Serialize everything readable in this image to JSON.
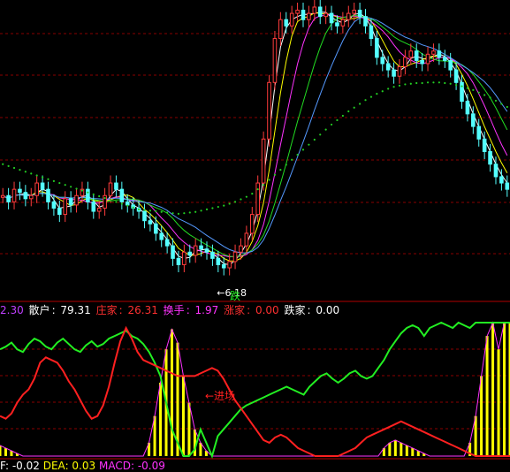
{
  "chart_data": [
    {
      "type": "candlestick",
      "title": "",
      "grid": true,
      "ylim": [
        5.8,
        10.4
      ],
      "annotations": {
        "low_label": "6.18",
        "low_arrow": "←",
        "signal_label": "跌"
      },
      "colors": {
        "up": "#ff3c3c",
        "down": "#54ffff",
        "ma_long": "#22cc22",
        "grid": "#8a0000"
      },
      "candles_close": [
        7.4,
        7.3,
        7.5,
        7.45,
        7.35,
        7.4,
        7.6,
        7.5,
        7.3,
        7.2,
        7.1,
        7.35,
        7.25,
        7.4,
        7.5,
        7.3,
        7.15,
        7.2,
        7.4,
        7.6,
        7.5,
        7.3,
        7.25,
        7.2,
        7.15,
        7.0,
        6.95,
        6.8,
        6.7,
        6.6,
        6.4,
        6.3,
        6.5,
        6.45,
        6.6,
        6.55,
        6.5,
        6.4,
        6.3,
        6.25,
        6.35,
        6.5,
        6.6,
        6.8,
        7.1,
        7.6,
        8.3,
        9.2,
        9.9,
        10.2,
        10.1,
        10.3,
        10.35,
        10.2,
        10.3,
        10.4,
        10.25,
        10.3,
        10.15,
        10.1,
        10.2,
        10.3,
        10.35,
        10.25,
        10.1,
        9.9,
        9.6,
        9.5,
        9.4,
        9.3,
        9.45,
        9.6,
        9.7,
        9.55,
        9.5,
        9.65,
        9.7,
        9.6,
        9.55,
        9.4,
        9.2,
        8.9,
        8.7,
        8.5,
        8.3,
        8.1,
        7.9,
        7.7,
        7.6,
        7.5
      ],
      "ma_long_values": [
        7.9,
        7.87,
        7.84,
        7.81,
        7.78,
        7.75,
        7.72,
        7.69,
        7.66,
        7.63,
        7.6,
        7.57,
        7.54,
        7.51,
        7.48,
        7.45,
        7.42,
        7.39,
        7.36,
        7.33,
        7.3,
        7.27,
        7.24,
        7.21,
        7.18,
        7.17,
        7.16,
        7.15,
        7.14,
        7.13,
        7.12,
        7.11,
        7.12,
        7.13,
        7.14,
        7.16,
        7.18,
        7.2,
        7.22,
        7.24,
        7.27,
        7.3,
        7.34,
        7.38,
        7.43,
        7.5,
        7.57,
        7.65,
        7.73,
        7.81,
        7.89,
        7.97,
        8.05,
        8.13,
        8.21,
        8.29,
        8.37,
        8.45,
        8.53,
        8.6,
        8.67,
        8.74,
        8.8,
        8.86,
        8.92,
        8.97,
        9.02,
        9.06,
        9.1,
        9.13,
        9.15,
        9.17,
        9.18,
        9.19,
        9.19,
        9.2,
        9.2,
        9.2,
        9.19,
        9.18,
        9.16,
        9.14,
        9.11,
        9.08,
        9.04,
        9.0,
        8.96,
        8.91,
        8.86,
        8.81
      ]
    },
    {
      "type": "line",
      "ylim": [
        0,
        100
      ],
      "legend": [
        {
          "name": "",
          "value": "2.30",
          "color": "#c040ff"
        },
        {
          "name": "散户",
          "value": "79.31",
          "color": "#ffffff"
        },
        {
          "name": "庄家",
          "value": "26.31",
          "color": "#ff3030"
        },
        {
          "name": "换手",
          "value": "1.97",
          "color": "#ff33ff"
        },
        {
          "name": "涨家",
          "value": "0.00",
          "color": "#ff3030"
        },
        {
          "name": "跌家",
          "value": "0.00",
          "color": "#ffffff"
        }
      ],
      "annotation": "进场",
      "series": [
        {
          "name": "散户",
          "color": "#22ee22",
          "values": [
            80,
            82,
            85,
            80,
            78,
            84,
            88,
            86,
            82,
            80,
            85,
            88,
            84,
            80,
            78,
            83,
            86,
            82,
            84,
            88,
            90,
            92,
            94,
            90,
            88,
            84,
            78,
            70,
            60,
            40,
            20,
            10,
            0,
            0,
            5,
            20,
            10,
            0,
            15,
            20,
            25,
            30,
            35,
            38,
            40,
            42,
            44,
            46,
            48,
            50,
            52,
            50,
            48,
            46,
            52,
            56,
            60,
            62,
            58,
            55,
            58,
            62,
            64,
            60,
            58,
            60,
            66,
            72,
            80,
            86,
            92,
            96,
            98,
            96,
            90,
            96,
            98,
            100,
            98,
            96,
            100,
            98,
            96,
            100,
            100,
            100,
            100,
            100,
            100,
            100
          ]
        },
        {
          "name": "庄家",
          "color": "#ff2020",
          "values": [
            30,
            28,
            32,
            40,
            46,
            50,
            58,
            70,
            74,
            72,
            70,
            64,
            56,
            50,
            42,
            34,
            28,
            30,
            38,
            52,
            70,
            86,
            96,
            88,
            78,
            72,
            70,
            68,
            66,
            64,
            62,
            60,
            60,
            60,
            60,
            62,
            64,
            66,
            64,
            58,
            50,
            42,
            36,
            30,
            24,
            18,
            12,
            10,
            14,
            16,
            14,
            10,
            6,
            4,
            2,
            0,
            0,
            0,
            0,
            0,
            2,
            4,
            6,
            10,
            14,
            16,
            18,
            20,
            22,
            24,
            26,
            24,
            22,
            20,
            18,
            16,
            14,
            12,
            10,
            8,
            6,
            4,
            2,
            0,
            0,
            0,
            0,
            0,
            0,
            0
          ]
        },
        {
          "name": "换手",
          "type": "bar",
          "color": "#ffff00",
          "values": [
            8,
            6,
            4,
            2,
            0,
            0,
            0,
            0,
            0,
            0,
            0,
            0,
            0,
            0,
            0,
            0,
            0,
            0,
            0,
            0,
            0,
            0,
            0,
            0,
            0,
            0,
            10,
            30,
            55,
            80,
            95,
            85,
            60,
            40,
            20,
            10,
            4,
            0,
            0,
            0,
            0,
            0,
            0,
            0,
            0,
            0,
            0,
            0,
            0,
            0,
            0,
            0,
            0,
            0,
            0,
            0,
            0,
            0,
            0,
            0,
            0,
            0,
            0,
            0,
            0,
            0,
            0,
            6,
            10,
            12,
            10,
            8,
            6,
            4,
            2,
            0,
            0,
            0,
            0,
            0,
            0,
            0,
            10,
            30,
            60,
            90,
            100,
            80,
            100,
            100
          ]
        }
      ]
    }
  ],
  "macd_bar": [
    {
      "name": "F",
      "value": "-0.02",
      "color": "#ffffff"
    },
    {
      "name": "DEA",
      "value": "0.03",
      "color": "#ffff00"
    },
    {
      "name": "MACD",
      "value": "-0.09",
      "color": "#ff33ff"
    }
  ]
}
